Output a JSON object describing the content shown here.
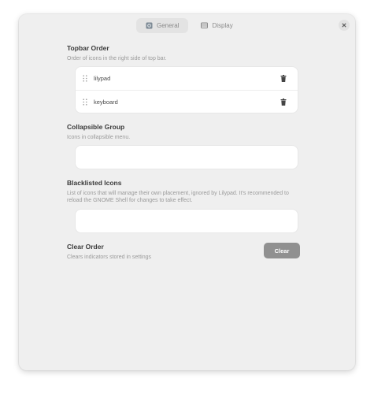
{
  "tabs": [
    {
      "label": "General",
      "icon": "settings-icon",
      "active": true
    },
    {
      "label": "Display",
      "icon": "display-icon",
      "active": false
    }
  ],
  "close_icon": "close-icon",
  "topbar_order": {
    "title": "Topbar Order",
    "subtitle": "Order of icons in the right side of top bar.",
    "items": [
      {
        "label": "lilypad"
      },
      {
        "label": "keyboard"
      }
    ]
  },
  "collapsible_group": {
    "title": "Collapsible Group",
    "subtitle": "Icons in collapsible menu."
  },
  "blacklisted_icons": {
    "title": "Blacklisted Icons",
    "subtitle": "List of icons that will manage their own placement, ignored by Lilypad. It's recommended to reload the GNOME Shell for changes to take effect."
  },
  "clear_order": {
    "title": "Clear Order",
    "subtitle": "Clears indicators stored in settings",
    "button_label": "Clear"
  },
  "colors": {
    "window_bg": "#efefef",
    "box_bg": "#ffffff",
    "clear_button_bg": "#909090"
  }
}
